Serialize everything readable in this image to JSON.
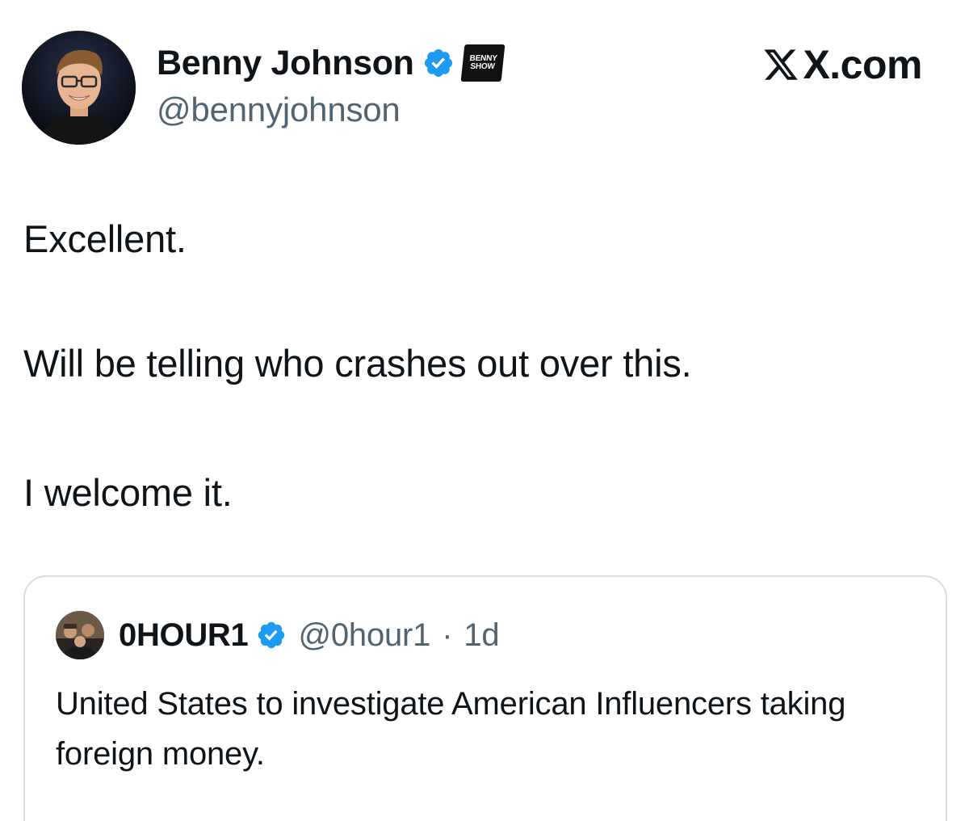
{
  "tweet": {
    "author": {
      "display_name": "Benny Johnson",
      "handle": "@bennyjohnson",
      "verified_icon": "verified-badge-icon",
      "affiliate_badge": [
        "BENNY",
        "SHOW"
      ],
      "avatar_icon": "profile-photo"
    },
    "brand": "X.com",
    "lines": [
      "Excellent.",
      "Will be telling who crashes out over this.",
      "I welcome it."
    ]
  },
  "quoted_tweet": {
    "display_name": "0HOUR1",
    "handle": "@0hour1",
    "separator": "·",
    "age": "1d",
    "text": "United States to investigate American Influencers taking foreign money.",
    "verified_icon": "verified-badge-icon",
    "avatar_icon": "group-photo"
  },
  "colors": {
    "text": "#0f1419",
    "secondary_text": "#536471",
    "verified_blue": "#1d9bf0",
    "card_border": "#d6dde3"
  }
}
